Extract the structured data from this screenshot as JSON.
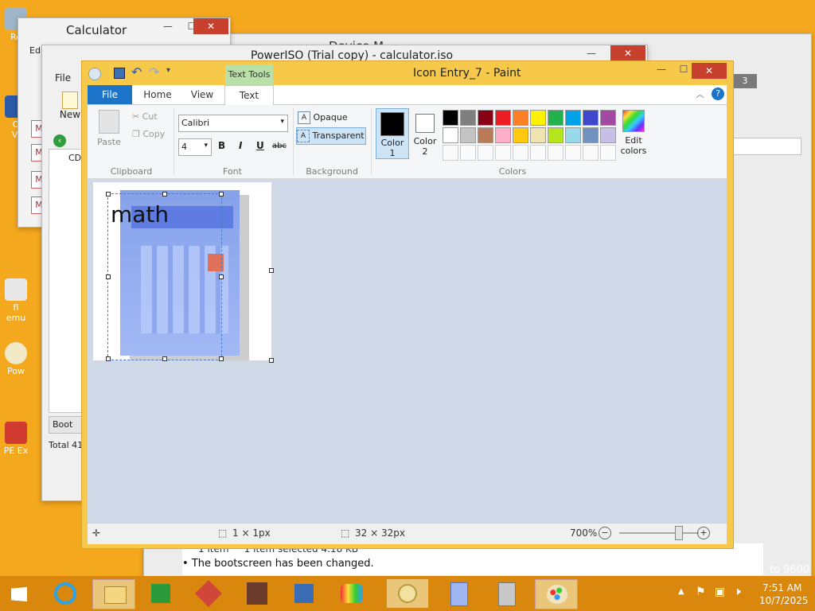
{
  "desktop": {
    "icons": [
      {
        "label": "Re"
      },
      {
        "label": "O\nVi"
      },
      {
        "label": "fl\nemu"
      },
      {
        "label": "Pow"
      },
      {
        "label": "PE Ex"
      }
    ]
  },
  "calculator_window": {
    "title": "Calculator",
    "menu_fragment": "Edi",
    "buttons": [
      "M",
      "M",
      "M",
      "M"
    ]
  },
  "poweriso_window": {
    "title": "PowerISO (Trial copy) - calculator.iso",
    "file_menu": "File",
    "new_label": "New",
    "tree": {
      "root": "CD"
    },
    "boot_label": "Boot",
    "total_label": "Total 41",
    "status_item": "1 item",
    "status_selected": "1 item selected  4.18 KB"
  },
  "back_window": {
    "title_fragment": "Device M",
    "badge": "3",
    "message": "The bootscreen has been changed.",
    "build": "to 9600"
  },
  "paint": {
    "title": "Icon Entry_7 - Paint",
    "text_tools_label": "Text Tools",
    "tabs": {
      "file": "File",
      "home": "Home",
      "view": "View",
      "text": "Text"
    },
    "clipboard": {
      "paste": "Paste",
      "cut": "Cut",
      "copy": "Copy",
      "label": "Clipboard"
    },
    "font": {
      "family": "Calibri",
      "size": "4",
      "bold": "B",
      "italic": "I",
      "underline": "U",
      "strike": "abc",
      "label": "Font"
    },
    "background": {
      "opaque": "Opaque",
      "transparent": "Transparent",
      "label": "Background"
    },
    "colors": {
      "color1_label": "Color\n1",
      "color2_label": "Color\n2",
      "edit_label": "Edit\ncolors",
      "label": "Colors",
      "color1": "#000000",
      "color2": "#ffffff",
      "palette_row1": [
        "#000000",
        "#7f7f7f",
        "#880015",
        "#ed1c24",
        "#ff7f27",
        "#fff200",
        "#22b14c",
        "#00a2e8",
        "#3f48cc",
        "#a349a4"
      ],
      "palette_row2": [
        "#ffffff",
        "#c3c3c3",
        "#b97a57",
        "#ffaec9",
        "#ffc90e",
        "#efe4b0",
        "#b5e61d",
        "#99d9ea",
        "#7092be",
        "#c8bfe7"
      ]
    },
    "canvas_text": "math",
    "status": {
      "selection": "1 × 1px",
      "size": "32 × 32px",
      "zoom": "700%"
    }
  },
  "taskbar": {
    "time": "7:51 AM",
    "date": "10/7/2025"
  }
}
